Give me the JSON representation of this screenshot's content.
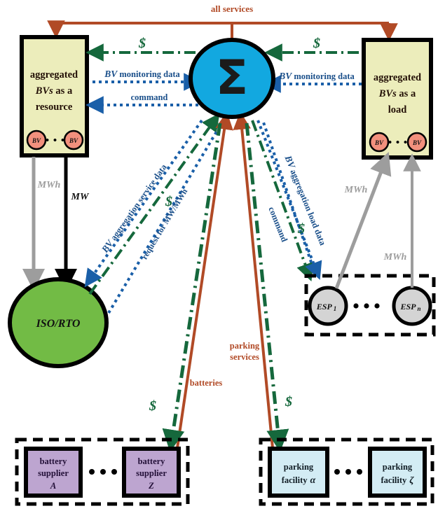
{
  "diagram": {
    "title_flows": {
      "all_services": "all services",
      "batteries": "batteries",
      "parking_services": "parking services"
    },
    "colors": {
      "brown": "#b14a26",
      "green_money": "#15683c",
      "blue_data": "#1a5fa8",
      "aggregator_fill": "#12a8e0",
      "box_fill_yellow": "#ecedbb",
      "iso_fill": "#72bb45",
      "esp_fill": "#d4d4d4",
      "bv_fill": "#f2907d",
      "battery_fill": "#bda5d0",
      "parking_fill": "#d3ecf4",
      "gray_arrow": "#9d9d9d",
      "black": "#000000"
    },
    "nodes": {
      "aggregator": {
        "name": "aggregator-sigma-node",
        "label": "Σ"
      },
      "resource_box": {
        "line1": "aggregated",
        "line2_italic": "BVs",
        "line2_rest": " as a",
        "line3": "resource",
        "unit_label": "BV",
        "ellipsis": "• • •"
      },
      "load_box": {
        "line1": "aggregated",
        "line2_italic": "BVs",
        "line2_rest": " as a",
        "line3": "load",
        "unit_label": "BV",
        "ellipsis": "• • •"
      },
      "iso": {
        "label": "ISO/RTO"
      },
      "esp_group": {
        "first": "ESP",
        "first_sub": "1",
        "last": "ESP",
        "last_sub": "n",
        "ellipsis": "• • •"
      },
      "battery_group": {
        "first_l1": "battery",
        "first_l2": "supplier",
        "first_l3": "A",
        "last_l1": "battery",
        "last_l2": "supplier",
        "last_l3": "Z",
        "ellipsis": "• • •"
      },
      "parking_group": {
        "first_l1": "parking",
        "first_l2": "facility",
        "first_sym": "α",
        "last_l1": "parking",
        "last_l2": "facility",
        "last_sym": "ζ",
        "ellipsis": "• • •"
      }
    },
    "edge_labels": {
      "money_left": "$",
      "money_right": "$",
      "bv_monitoring_left_italic": "BV",
      "bv_monitoring_left_rest": " monitoring data",
      "bv_monitoring_right_italic": "BV",
      "bv_monitoring_right_rest": " monitoring data",
      "command_left": "command",
      "mwh_left": "MWh",
      "mw_left": "MW",
      "bv_agg_service_data_italic": "BV",
      "bv_agg_service_data_rest": " aggregation service data",
      "money_service": "$",
      "request_mw_mwh": "request for MW/MWh",
      "bv_agg_load_data_italic": "BV",
      "bv_agg_load_data_rest": " aggregation load data",
      "money_load": "$",
      "command_right": "command",
      "mwh_esp_1": "MWh",
      "mwh_esp_n": "MWh",
      "money_battery": "$",
      "money_parking": "$"
    }
  }
}
